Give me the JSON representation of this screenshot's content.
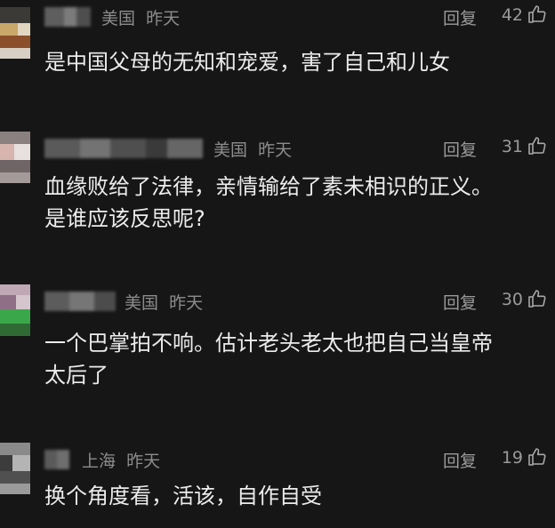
{
  "comments": [
    {
      "location": "美国",
      "time": "昨天",
      "reply_label": "回复",
      "likes": "42",
      "text": "是中国父母的无知和宠爱，害了自己和儿女"
    },
    {
      "location": "美国",
      "time": "昨天",
      "reply_label": "回复",
      "likes": "31",
      "text": "血缘败给了法律，亲情输给了素未相识的正义。\n是谁应该反思呢?"
    },
    {
      "location": "美国",
      "time": "昨天",
      "reply_label": "回复",
      "likes": "30",
      "text": "一个巴掌拍不响。估计老头老太也把自己当皇帝\n太后了"
    },
    {
      "location": "上海",
      "time": "昨天",
      "reply_label": "回复",
      "likes": "19",
      "text": "换个角度看，活该，自作自受"
    }
  ],
  "icons": {
    "like": "thumbs-up-icon"
  },
  "colors": {
    "background": "#161616",
    "body_text": "#ececec",
    "meta_text": "#8c8c8c"
  }
}
